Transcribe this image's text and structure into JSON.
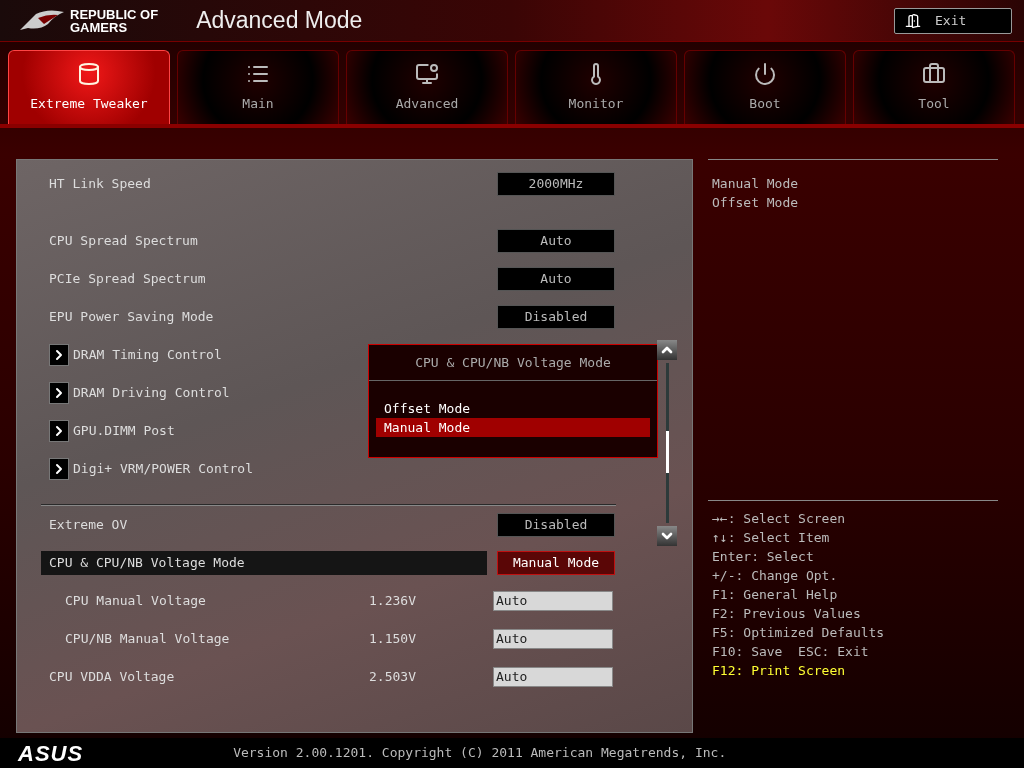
{
  "header": {
    "brand": [
      "REPUBLIC OF",
      "GAMERS"
    ],
    "title": "Advanced Mode",
    "exit_button": "Exit"
  },
  "tabs": [
    {
      "label": "Extreme Tweaker",
      "selected": true
    },
    {
      "label": "Main",
      "selected": false
    },
    {
      "label": "Advanced",
      "selected": false
    },
    {
      "label": "Monitor",
      "selected": false
    },
    {
      "label": "Boot",
      "selected": false
    },
    {
      "label": "Tool",
      "selected": false
    }
  ],
  "settings": [
    {
      "kind": "value",
      "label": "HT Link Speed",
      "value": "2000MHz",
      "selected": false
    },
    {
      "kind": "value",
      "label": "CPU Spread Spectrum",
      "value": "Auto",
      "selected": false
    },
    {
      "kind": "value",
      "label": "PCIe Spread Spectrum",
      "value": "Auto",
      "selected": false
    },
    {
      "kind": "value",
      "label": "EPU Power Saving Mode",
      "value": "Disabled",
      "selected": false
    },
    {
      "kind": "submenu",
      "label": "DRAM Timing Control",
      "selected": false
    },
    {
      "kind": "submenu",
      "label": "DRAM Driving Control",
      "selected": false
    },
    {
      "kind": "submenu",
      "label": "GPU.DIMM Post",
      "selected": false
    },
    {
      "kind": "submenu",
      "label": "Digi+ VRM/POWER Control",
      "selected": false
    },
    {
      "kind": "separator"
    },
    {
      "kind": "value",
      "label": "Extreme OV",
      "value": "Disabled",
      "selected": false
    },
    {
      "kind": "value",
      "label": "CPU & CPU/NB Voltage Mode",
      "value": "Manual Mode",
      "selected": true
    },
    {
      "kind": "voltage",
      "label": "CPU Manual Voltage",
      "reading": "1.236V",
      "value": "Auto",
      "sub": true,
      "selected": false
    },
    {
      "kind": "voltage",
      "label": "CPU/NB Manual Voltage",
      "reading": "1.150V",
      "value": "Auto",
      "sub": true,
      "selected": false
    },
    {
      "kind": "voltage",
      "label": "CPU VDDA Voltage",
      "reading": "2.503V",
      "value": "Auto",
      "sub": false,
      "selected": false
    }
  ],
  "popup": {
    "title": "CPU & CPU/NB Voltage Mode",
    "options": [
      {
        "label": "Offset Mode",
        "selected": false
      },
      {
        "label": "Manual Mode",
        "selected": true
      }
    ]
  },
  "help": {
    "items": [
      "Manual Mode",
      "Offset Mode"
    ]
  },
  "key_hints": [
    {
      "text": "→←: Select Screen",
      "highlight": false
    },
    {
      "text": "↑↓: Select Item",
      "highlight": false
    },
    {
      "text": "Enter: Select",
      "highlight": false
    },
    {
      "text": "+/-: Change Opt.",
      "highlight": false
    },
    {
      "text": "F1: General Help",
      "highlight": false
    },
    {
      "text": "F2: Previous Values",
      "highlight": false
    },
    {
      "text": "F5: Optimized Defaults",
      "highlight": false
    },
    {
      "text": "F10: Save  ESC: Exit",
      "highlight": false
    },
    {
      "text": "F12: Print Screen",
      "highlight": true
    }
  ],
  "footer": {
    "logo": "ASUS",
    "version": "Version 2.00.1201. Copyright (C) 2011 American Megatrends, Inc."
  }
}
